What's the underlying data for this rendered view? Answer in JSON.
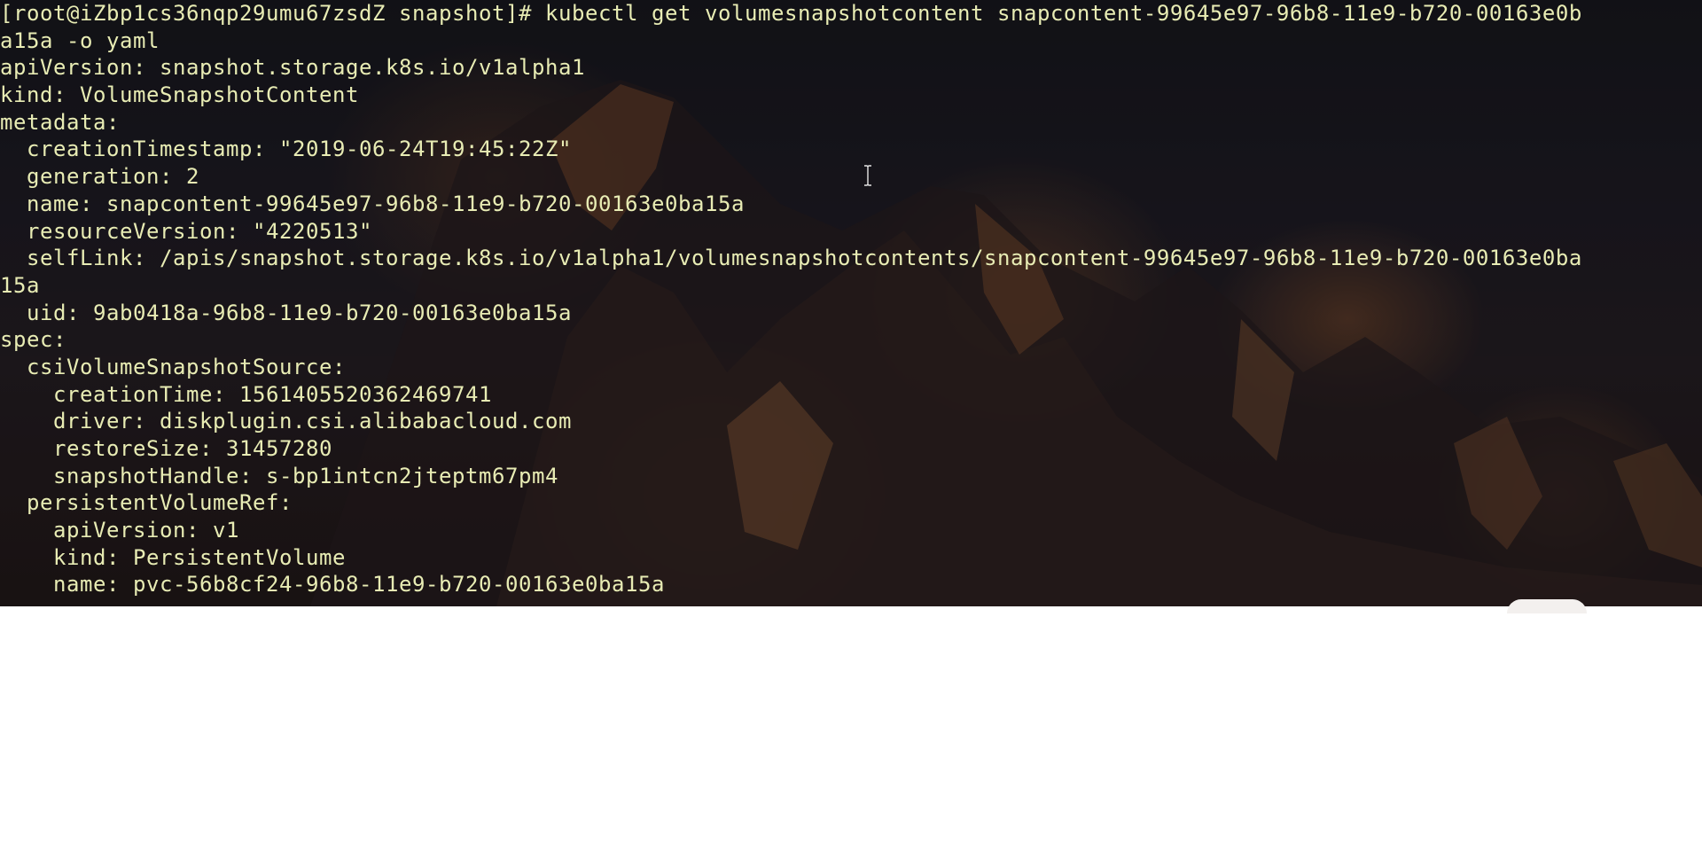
{
  "terminal": {
    "lines": [
      "[root@iZbp1cs36nqp29umu67zsdZ snapshot]# kubectl get volumesnapshotcontent snapcontent-99645e97-96b8-11e9-b720-00163e0b",
      "a15a -o yaml",
      "apiVersion: snapshot.storage.k8s.io/v1alpha1",
      "kind: VolumeSnapshotContent",
      "metadata:",
      "  creationTimestamp: \"2019-06-24T19:45:22Z\"",
      "  generation: 2",
      "  name: snapcontent-99645e97-96b8-11e9-b720-00163e0ba15a",
      "  resourceVersion: \"4220513\"",
      "  selfLink: /apis/snapshot.storage.k8s.io/v1alpha1/volumesnapshotcontents/snapcontent-99645e97-96b8-11e9-b720-00163e0ba",
      "15a",
      "  uid: 9ab0418a-96b8-11e9-b720-00163e0ba15a",
      "spec:",
      "  csiVolumeSnapshotSource:",
      "    creationTime: 1561405520362469741",
      "    driver: diskplugin.csi.alibabacloud.com",
      "    restoreSize: 31457280",
      "    snapshotHandle: s-bp1intcn2jteptm67pm4",
      "  persistentVolumeRef:",
      "    apiVersion: v1",
      "    kind: PersistentVolume",
      "    name: pvc-56b8cf24-96b8-11e9-b720-00163e0ba15a"
    ]
  },
  "icons": {
    "cursor": "text-cursor-icon"
  },
  "colors": {
    "terminal_text": "#e8ecb4",
    "page_background": "#ffffff"
  }
}
